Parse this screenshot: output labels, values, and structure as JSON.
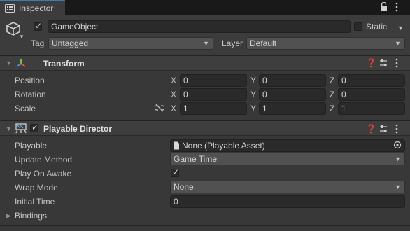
{
  "tab": {
    "icon": "info-icon",
    "label": "Inspector"
  },
  "tab_icons": {
    "lock": "lock-icon",
    "menu": "more-menu-icon"
  },
  "gameobject": {
    "icon": "cube-icon",
    "active": true,
    "name": "GameObject",
    "static_label": "Static",
    "static_checked": false,
    "tag_label": "Tag",
    "tag_value": "Untagged",
    "layer_label": "Layer",
    "layer_value": "Default"
  },
  "transform": {
    "title": "Transform",
    "icon": "transform-axes-icon",
    "rows": [
      {
        "label": "Position",
        "x": "0",
        "y": "0",
        "z": "0"
      },
      {
        "label": "Rotation",
        "x": "0",
        "y": "0",
        "z": "0"
      },
      {
        "label": "Scale",
        "x": "1",
        "y": "1",
        "z": "1"
      }
    ],
    "axis_labels": {
      "x": "X",
      "y": "Y",
      "z": "Z"
    }
  },
  "playable_director": {
    "title": "Playable Director",
    "icon": "playable-director-icon",
    "enabled": true,
    "playable_label": "Playable",
    "playable_value": "None (Playable Asset)",
    "update_method_label": "Update Method",
    "update_method_value": "Game Time",
    "play_on_awake_label": "Play On Awake",
    "play_on_awake": true,
    "wrap_mode_label": "Wrap Mode",
    "wrap_mode_value": "None",
    "initial_time_label": "Initial Time",
    "initial_time_value": "0",
    "bindings_label": "Bindings"
  },
  "colors": {
    "accent": "#3a79bb",
    "panel": "#383838",
    "field": "#2a2a2a"
  }
}
